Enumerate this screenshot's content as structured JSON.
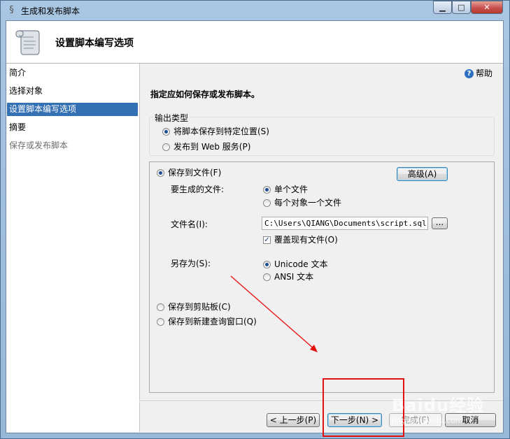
{
  "window": {
    "title": "生成和发布脚本",
    "minimize": "▁",
    "maximize": "□",
    "close": "✕"
  },
  "header": {
    "title": "设置脚本编写选项",
    "icon": "scroll-icon"
  },
  "nav": {
    "items": [
      {
        "label": "简介",
        "state": "normal"
      },
      {
        "label": "选择对象",
        "state": "normal"
      },
      {
        "label": "设置脚本编写选项",
        "state": "selected"
      },
      {
        "label": "摘要",
        "state": "normal"
      },
      {
        "label": "保存或发布脚本",
        "state": "disabled"
      }
    ]
  },
  "help": {
    "label": "帮助",
    "icon": "help-icon"
  },
  "instruction": "指定应如何保存或发布脚本。",
  "output_type": {
    "label": "输出类型",
    "options": [
      {
        "label": "将脚本保存到特定位置(S)",
        "selected": true
      },
      {
        "label": "发布到 Web 服务(P)",
        "selected": false
      }
    ]
  },
  "save": {
    "to_file": {
      "label": "保存到文件(F)",
      "selected": true
    },
    "advanced_button": "高级(A)",
    "files_to_generate": {
      "label": "要生成的文件:",
      "options": [
        {
          "label": "单个文件",
          "selected": true
        },
        {
          "label": "每个对象一个文件",
          "selected": false
        }
      ]
    },
    "file_name": {
      "label": "文件名(I):",
      "value": "C:\\Users\\QIANG\\Documents\\script.sql",
      "browse": "..."
    },
    "overwrite": {
      "label": "覆盖现有文件(O)",
      "checked": true
    },
    "save_as": {
      "label": "另存为(S):",
      "options": [
        {
          "label": "Unicode 文本",
          "selected": true
        },
        {
          "label": "ANSI 文本",
          "selected": false
        }
      ]
    },
    "to_clipboard": {
      "label": "保存到剪贴板(C)",
      "selected": false
    },
    "to_query_window": {
      "label": "保存到新建查询窗口(Q)",
      "selected": false
    }
  },
  "footer": {
    "prev": "< 上一步(P)",
    "next": "下一步(N) >",
    "finish": "完成(F)",
    "cancel": "取消"
  },
  "watermark": {
    "text": "Baidu经验",
    "sub": "jingyan.baidu.com"
  },
  "colors": {
    "selection": "#3470b4",
    "annotation": "#e41010",
    "title_bar": "#a9c6e2"
  }
}
